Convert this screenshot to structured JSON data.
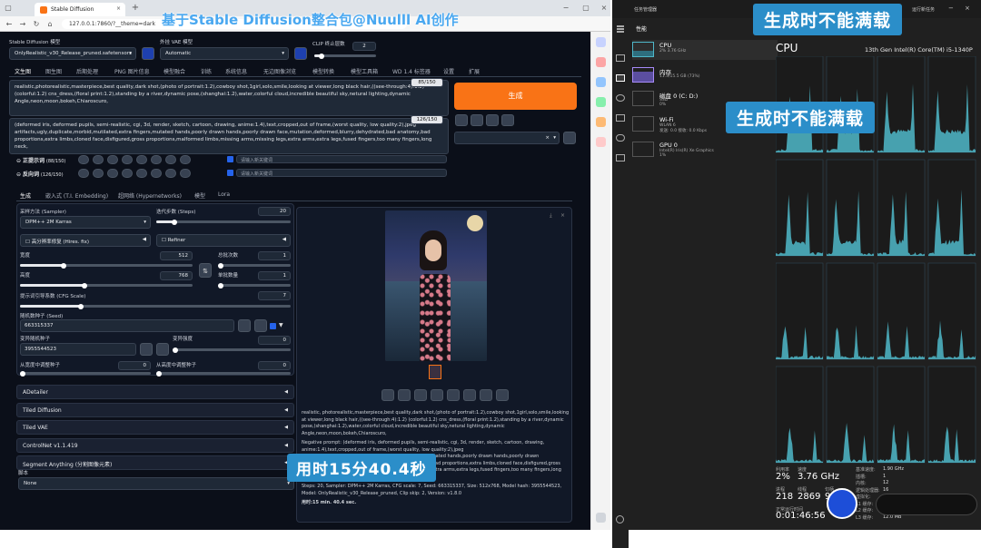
{
  "overlay_title": "基于Stable Diffusion整合包@Nuulll AI创作",
  "browser": {
    "tab_title": "Stable Diffusion",
    "url": "127.0.0.1:7860/?__theme=dark"
  },
  "webui": {
    "model_label": "Stable Diffusion 模型",
    "model_value": "OnlyRealistic_v30_Release_pruned.safetensors",
    "vae_label": "外挂 VAE 模型",
    "vae_value": "Automatic",
    "clip_label": "CLIP 终止层数",
    "clip_value": "2",
    "tabs": [
      "文生图",
      "图生图",
      "后期处理",
      "PNG 图片信息",
      "模型融合",
      "训练",
      "系统信息",
      "无边图像浏览",
      "模型转换",
      "模型工具箱",
      "WD 1.4 标签器",
      "设置",
      "扩展"
    ],
    "prompt": "realistic,photorealistic,masterpiece,best quality,dark shot,(photo of portrait:1.2),cowboy shot,1girl,solo,smile,looking at viewer,long black hair,((see-through:4):1.2) (colorful:1.2) cns_dress,(floral print:1.2),standing by a river,dynamic pose,(shanghai:1.2),water,colorful cloud,incredible beautiful sky,netural lighting,dynamic Angle,neon,moon,bokeh,Chiaroscuro,",
    "prompt_count": "85/150",
    "neg_prompt": "(deformed iris, deformed pupils, semi-realistic, cgi, 3d, render, sketch, cartoon, drawing, anime:1.4),text,cropped,out of frame,(worst quality, low quality:2),jpeg artifacts,ugly,duplicate,morbid,mutilated,extra fingers,mutated hands,poorly drawn hands,poorly drawn face,mutation,deformed,blurry,dehydrated,bad anatomy,bad proportions,extra limbs,cloned face,disfigured,gross proportions,malformed limbs,missing arms,missing legs,extra arms,extra legs,fused fingers,too many fingers,long neck,",
    "neg_count": "126/150",
    "generate_label": "生成",
    "pos_tag_label": "正提示词",
    "pos_tag_count": "(88/150)",
    "neg_tag_label": "反向词",
    "neg_tag_count": "(126/150)",
    "keyword_ph": "请输入新关键词",
    "subtabs": [
      "生成",
      "嵌入式 (T.I. Embedding)",
      "超网络 (Hypernetworks)",
      "模型",
      "Lora"
    ],
    "sampler_label": "采样方法 (Sampler)",
    "sampler_value": "DPM++ 2M Karras",
    "steps_label": "迭代步数 (Steps)",
    "steps_value": "20",
    "hires_label": "高分辨率修复 (Hires. fix)",
    "refiner_label": "Refiner",
    "width_label": "宽度",
    "width_value": "512",
    "height_label": "高度",
    "height_value": "768",
    "batch_count_label": "总批次数",
    "batch_count_value": "1",
    "batch_size_label": "单批数量",
    "batch_size_value": "1",
    "cfg_label": "提示词引导系数 (CFG Scale)",
    "cfg_value": "7",
    "seed_label": "随机数种子 (Seed)",
    "seed_value": "663315337",
    "var_seed_label": "变异随机种子",
    "var_seed_value": "3955544523",
    "var_strength_label": "变异强度",
    "var_strength_value": "0",
    "resize_w_label": "从宽度中调整种子",
    "resize_w_value": "0",
    "resize_h_label": "从高度中调整种子",
    "resize_h_value": "0",
    "accordions": [
      "ADetailer",
      "Tiled Diffusion",
      "Tiled VAE",
      "ControlNet v1.1.419",
      "Segment Anything (分割图像元素)"
    ],
    "script_label": "脚本",
    "script_value": "None",
    "output_text": "realistic, photorealistic,masterpiece,best quality,dark shot,(photo of portrait:1.2),cowboy shot,1girl,solo,smile,looking at viewer,long black hair,((see-through:4):1.2) (colorful:1.2) cns_dress,(floral print:1.2),standing by a river,dynamic pose,(shanghai:1.2),water,colorful cloud,incredible beautiful sky,netural lighting,dynamic Angle,neon,moon,bokeh,Chiaroscuro,",
    "output_neg": "Negative prompt: (deformed iris, deformed pupils, semi-realistic, cgi, 3d, render, sketch, cartoon, drawing, anime:1.4),text,cropped,out of frame,(worst quality, low quality:2),jpeg artifacts,ugly,duplicate,morbid,mutilated,extra fingers,mutated hands,poorly drawn hands,poorly drawn face,mutation,deformed,blurry,dehydrated,bad anatomy,bad proportions,extra limbs,cloned face,disfigured,gross proportions,malformed limbs,missing arms,missing legs,extra arms,extra legs,fused fingers,too many fingers,long neck,",
    "output_params": "Steps: 20, Sampler: DPM++ 2M Karras, CFG scale: 7, Seed: 663315337, Size: 512x768, Model hash: 3955544523, Model: OnlyRealistic_v30_Release_pruned, Clip skip: 2, Version: v1.8.0",
    "time_taken": "用时:15 min. 40.4 sec."
  },
  "callouts": {
    "time": "用时15分40.4秒",
    "cpu_not_full_1": "生成时不能满载",
    "cpu_not_full_2": "生成时不能满载"
  },
  "taskmgr": {
    "title": "任务管理器",
    "section": "性能",
    "run_task": "运行新任务",
    "cpu_heading": "CPU",
    "cpu_name": "13th Gen Intel(R) Core(TM) i5-1340P",
    "items": [
      {
        "name": "CPU",
        "sub": "2% 3.76 GHz"
      },
      {
        "name": "内存",
        "sub": "11.3/15.5 GB (73%)"
      },
      {
        "name": "磁盘 0 (C: D:)",
        "sub": "SSD",
        "sub2": "0%"
      },
      {
        "name": "Wi-Fi",
        "sub": "WLAN 6",
        "sub2": "发送: 0.0 接收: 0.0 Kbps"
      },
      {
        "name": "GPU 0",
        "sub": "Intel(R) Iris(R) Xe Graphics",
        "sub2": "1%"
      }
    ],
    "stats": {
      "util_label": "利用率",
      "util": "2%",
      "speed_label": "速度",
      "speed": "3.76 GHz",
      "proc_label": "进程",
      "proc": "218",
      "thread_label": "线程",
      "thread": "2869",
      "handle_label": "句柄",
      "handle": "96",
      "uptime_label": "正常运行时间",
      "uptime": "0:01:46:56",
      "base_label": "基准速度:",
      "base": "1.90 GHz",
      "sockets_label": "插槽:",
      "sockets": "1",
      "cores_label": "内核:",
      "cores": "12",
      "lp_label": "逻辑处理器:",
      "lp": "16",
      "virt_label": "虚拟化:",
      "virt": "已启用",
      "l1_label": "L1 缓存:",
      "l1": "1.1 MB",
      "l2_label": "L2 缓存:",
      "l2": "9.0 MB",
      "l3_label": "L3 缓存:",
      "l3": "12.0 MB"
    }
  },
  "colors": {
    "accent": "#f97316",
    "callout": "#2b8ec9",
    "graph": "#4fb8c9"
  }
}
